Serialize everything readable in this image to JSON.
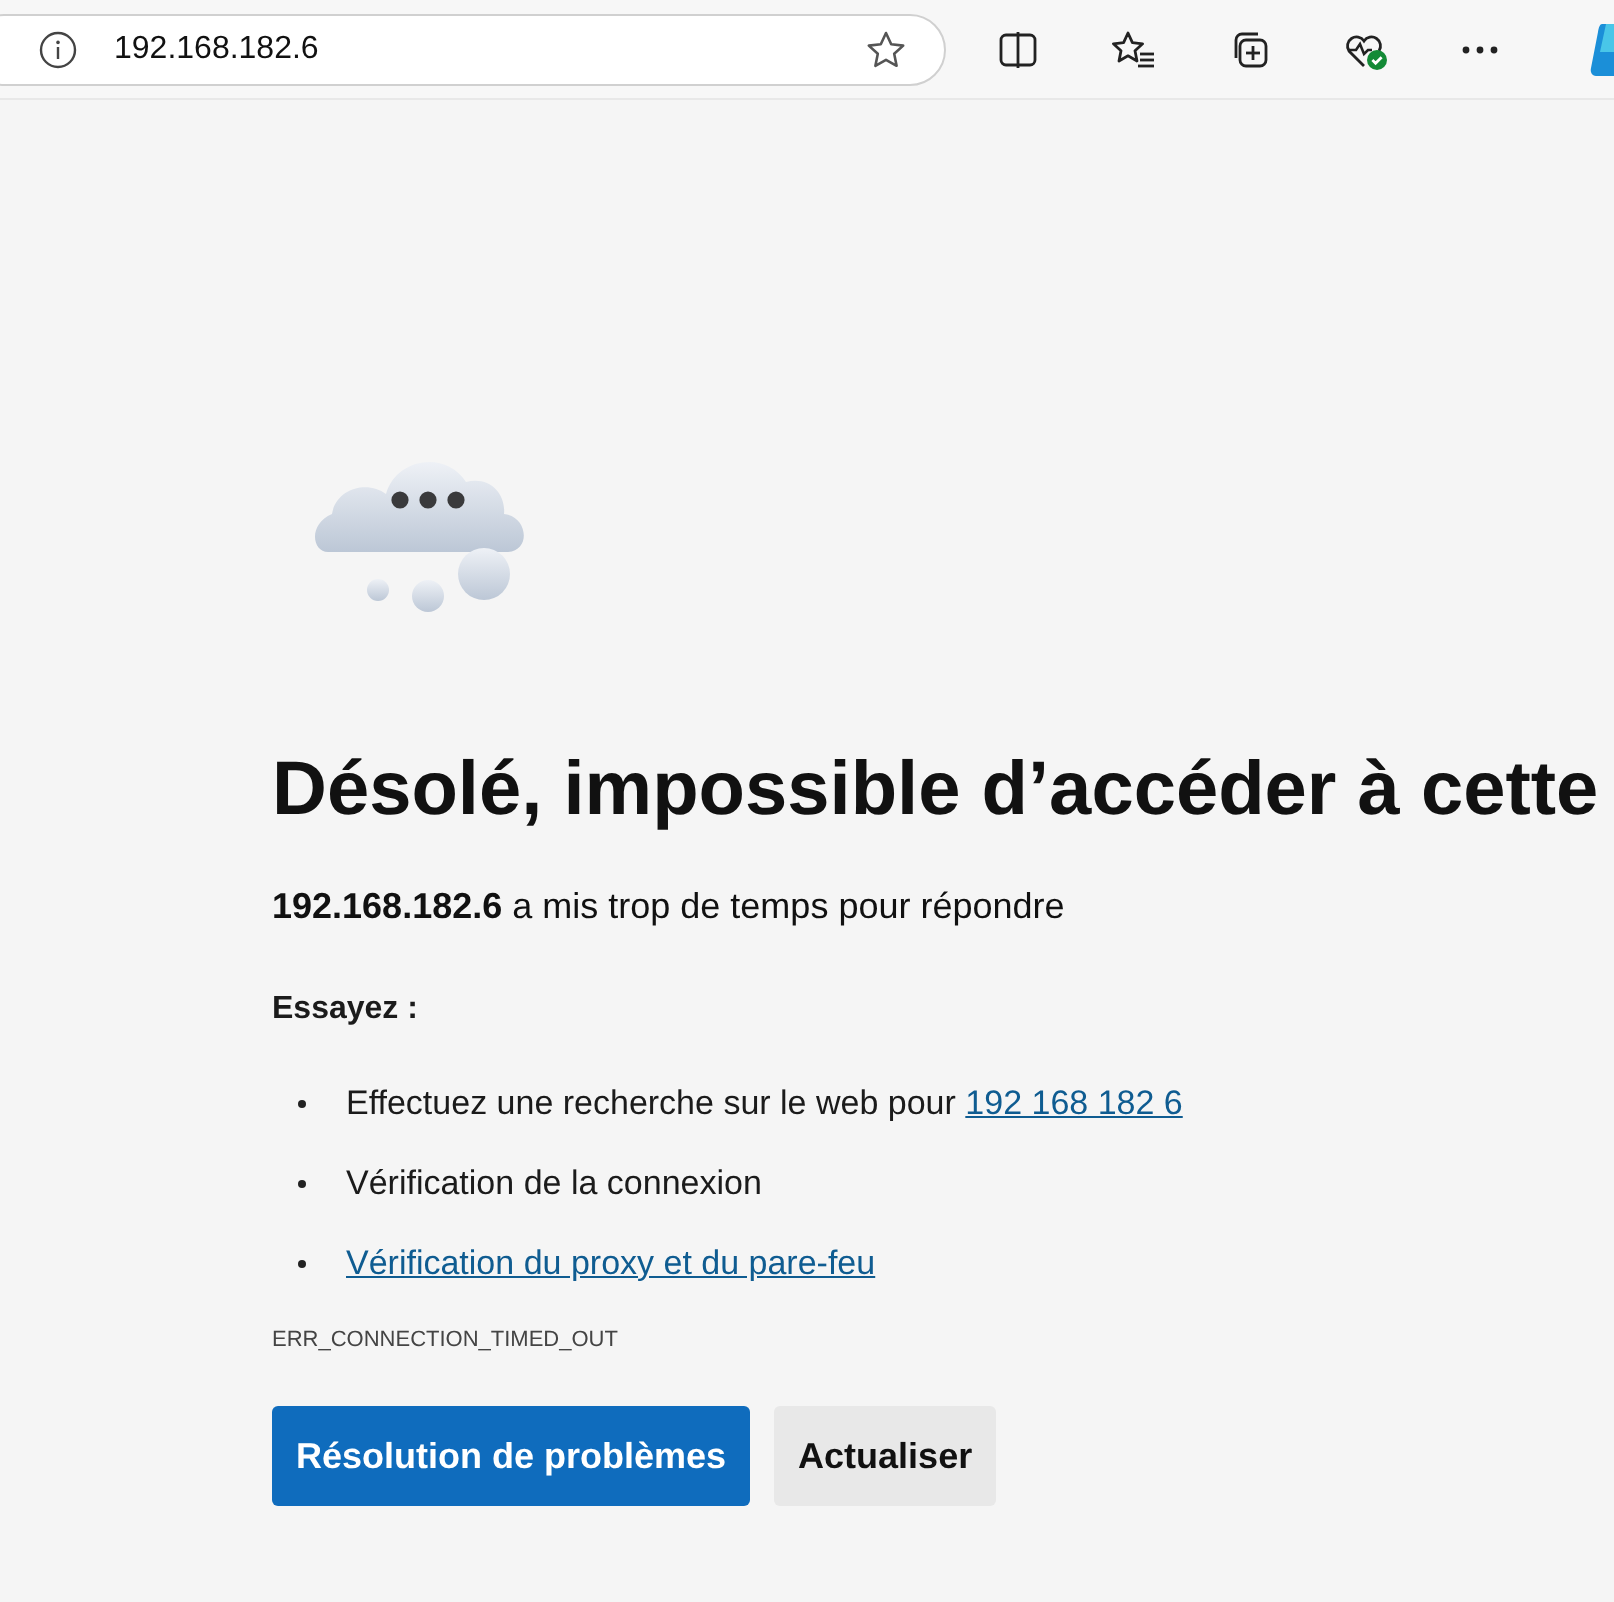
{
  "address_bar": {
    "url": "192.168.182.6"
  },
  "error_page": {
    "heading": "Désolé, impossible d’accéder à cette",
    "message": "**192.168.182.6** a mis trop de temps pour répondre",
    "try_label": "Essayez :",
    "suggestions": [
      {
        "kind": "text_link",
        "text": "Effectuez une recherche sur le web pour ",
        "link": "192 168 182 6"
      },
      {
        "kind": "text",
        "text": "Vérification de la connexion"
      },
      {
        "kind": "link",
        "link": "Vérification du proxy et du pare-feu"
      }
    ],
    "error_code": "ERR_CONNECTION_TIMED_OUT",
    "buttons": [
      {
        "kind": "primary",
        "label": "Résolution de problèmes"
      },
      {
        "kind": "secondary",
        "label": "Actualiser"
      }
    ]
  }
}
